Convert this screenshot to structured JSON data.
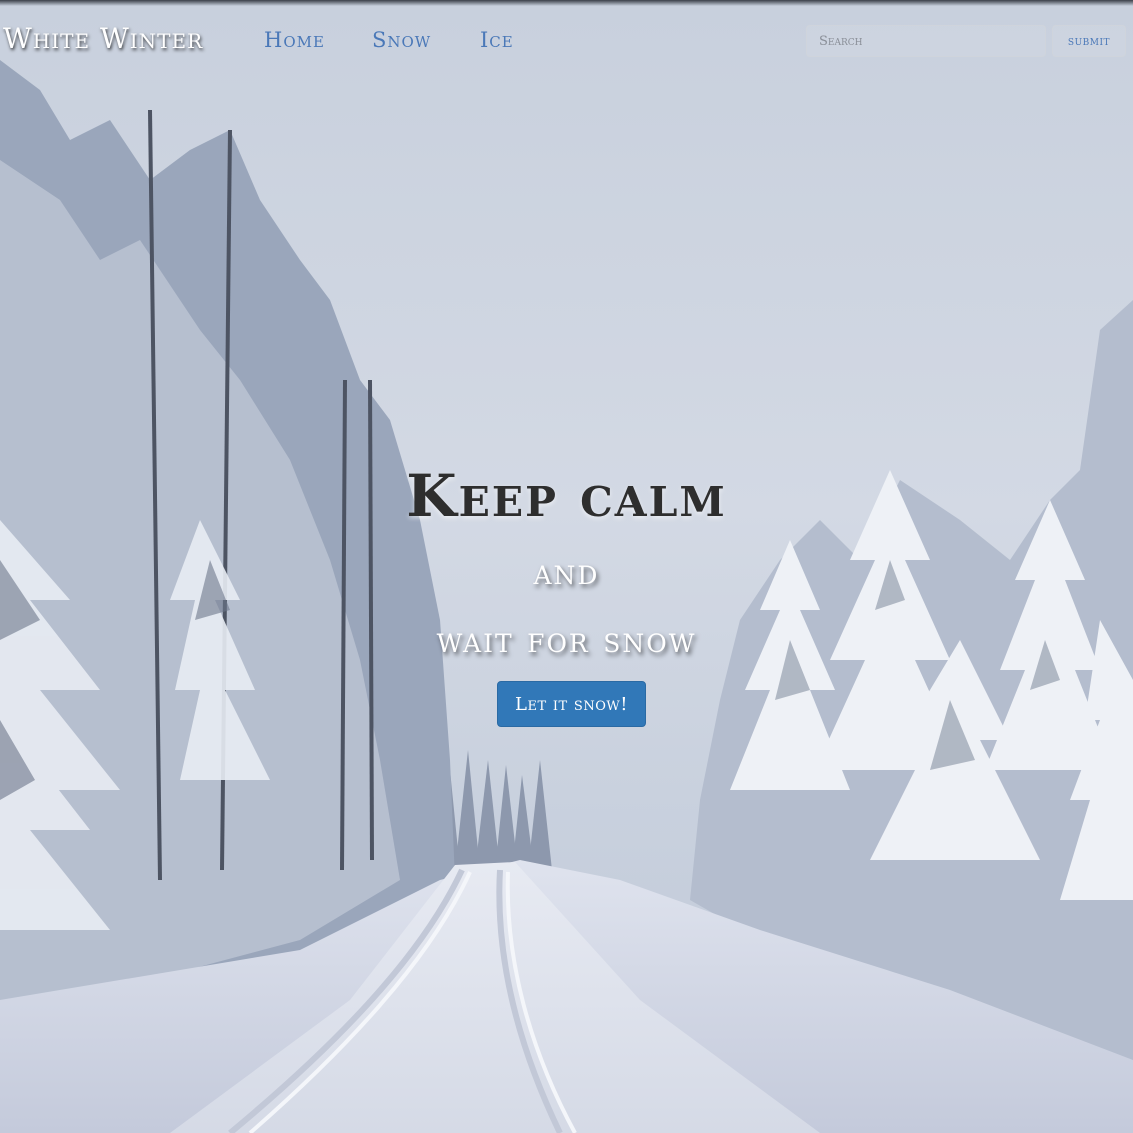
{
  "navbar": {
    "brand": "White Winter",
    "links": [
      {
        "label": "Home"
      },
      {
        "label": "Snow"
      },
      {
        "label": "Ice"
      }
    ],
    "search": {
      "placeholder": "Search",
      "value": ""
    },
    "submit_label": "submit"
  },
  "hero": {
    "line1": "Keep calm",
    "line2": "and",
    "line3": "wait for snow",
    "button_label": "Let it snow!"
  },
  "colors": {
    "link": "#4a78b8",
    "button": "#3178b8",
    "sky": "#cfd6e2"
  }
}
